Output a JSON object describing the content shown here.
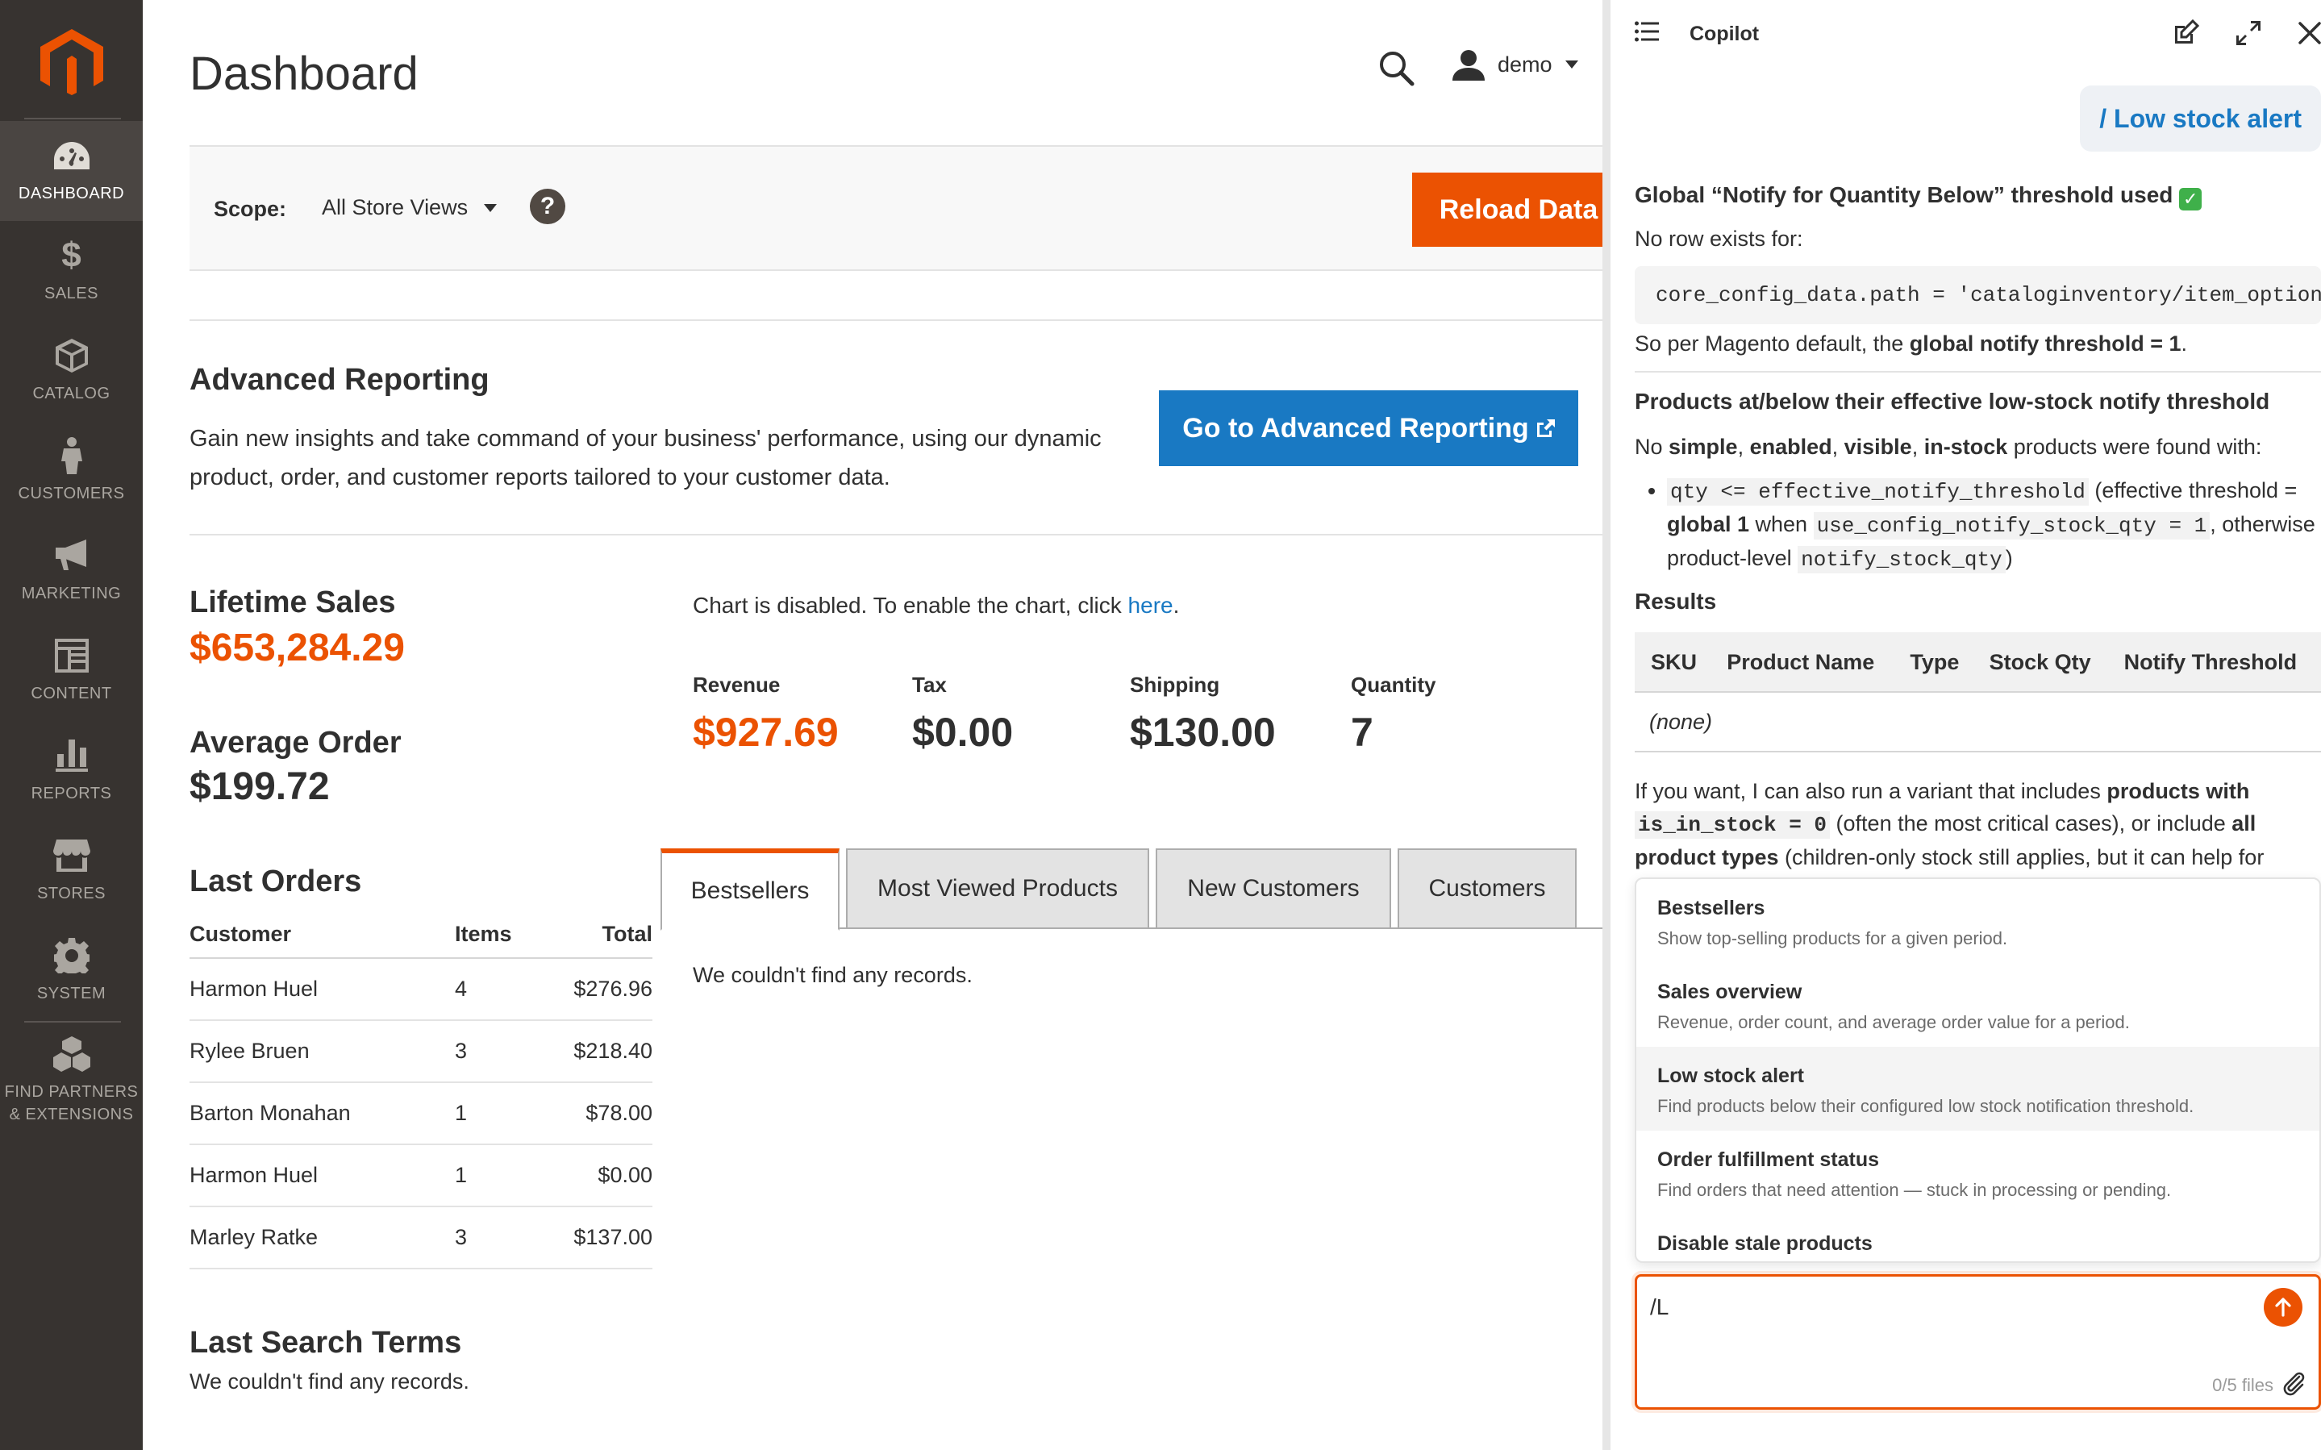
{
  "sidebar": {
    "items": [
      {
        "label": "DASHBOARD",
        "icon": "dashboard-icon",
        "active": true
      },
      {
        "label": "SALES",
        "icon": "dollar-icon"
      },
      {
        "label": "CATALOG",
        "icon": "box-icon"
      },
      {
        "label": "CUSTOMERS",
        "icon": "person-icon"
      },
      {
        "label": "MARKETING",
        "icon": "megaphone-icon"
      },
      {
        "label": "CONTENT",
        "icon": "layout-icon"
      },
      {
        "label": "REPORTS",
        "icon": "bar-chart-icon"
      },
      {
        "label": "STORES",
        "icon": "storefront-icon"
      },
      {
        "label": "SYSTEM",
        "icon": "gear-icon"
      },
      {
        "label_line1": "FIND PARTNERS",
        "label_line2": "& EXTENSIONS",
        "icon": "cubes-icon"
      }
    ],
    "sales_symbol": "$"
  },
  "header": {
    "title": "Dashboard",
    "user": "demo"
  },
  "scope": {
    "label": "Scope:",
    "value": "All Store Views",
    "help": "?",
    "reload_label": "Reload Data"
  },
  "advanced": {
    "title": "Advanced Reporting",
    "text": "Gain new insights and take command of your business' performance, using our dynamic product, order, and customer reports tailored to your customer data.",
    "button": "Go to Advanced Reporting"
  },
  "stats": {
    "lifetime_label": "Lifetime Sales",
    "lifetime_value": "$653,284.29",
    "average_label": "Average Order",
    "average_value": "$199.72"
  },
  "chart_note": {
    "text": "Chart is disabled. To enable the chart, click ",
    "link": "here",
    "tail": "."
  },
  "totals": [
    {
      "label": "Revenue",
      "value": "$927.69"
    },
    {
      "label": "Tax",
      "value": "$0.00"
    },
    {
      "label": "Shipping",
      "value": "$130.00"
    },
    {
      "label": "Quantity",
      "value": "7"
    }
  ],
  "last_orders": {
    "title": "Last Orders",
    "headers": [
      "Customer",
      "Items",
      "Total"
    ],
    "rows": [
      [
        "Harmon Huel",
        "4",
        "$276.96"
      ],
      [
        "Rylee Bruen",
        "3",
        "$218.40"
      ],
      [
        "Barton Monahan",
        "1",
        "$78.00"
      ],
      [
        "Harmon Huel",
        "1",
        "$0.00"
      ],
      [
        "Marley Ratke",
        "3",
        "$137.00"
      ]
    ]
  },
  "last_search": {
    "title": "Last Search Terms",
    "text": "We couldn't find any records."
  },
  "tabs": {
    "items": [
      "Bestsellers",
      "Most Viewed Products",
      "New Customers",
      "Customers"
    ],
    "active": 0,
    "content": "We couldn't find any records."
  },
  "copilot": {
    "title": "Copilot",
    "user_message": "/ Low stock alert",
    "h1": "Global “Notify for Quantity Below” threshold used",
    "no_row": "No row exists for:",
    "code": "core_config_data.path = 'cataloginventory/item_options/notify_stock_qty'",
    "per_default_prefix": "So per Magento default, the ",
    "per_default_bold": "global notify threshold = 1",
    "per_default_suffix": ".",
    "h2": "Products at/below their effective low-stock notify threshold",
    "p2_prefix": "No ",
    "p2_b1": "simple",
    "p2_s1": ", ",
    "p2_b2": "enabled",
    "p2_s2": ", ",
    "p2_b3": "visible",
    "p2_s3": ", ",
    "p2_b4": "in-stock",
    "p2_suffix": " products were found with:",
    "bullet_code1": "qty <= effective_notify_threshold",
    "bullet_t1": " (effective threshold = ",
    "bullet_b1": "global 1",
    "bullet_t2": " when ",
    "bullet_code2": "use_config_notify_stock_qty = 1",
    "bullet_t3": ", otherwise product-level ",
    "bullet_code3": "notify_stock_qty",
    "bullet_t4": ")",
    "results_label": "Results",
    "result_headers": [
      "SKU",
      "Product Name",
      "Type",
      "Stock Qty",
      "Notify Threshold"
    ],
    "result_empty": "(none)",
    "followup_t1": "If you want, I can also run a variant that includes ",
    "followup_b1": "products with",
    "followup_code": "is_in_stock = 0",
    "followup_t2": " (often the most critical cases), or include ",
    "followup_b2": "all product types",
    "followup_t3": " (children-only stock still applies, but it can help for",
    "suggestions": [
      {
        "title": "Bestsellers",
        "desc": "Show top-selling products for a given period."
      },
      {
        "title": "Sales overview",
        "desc": "Revenue, order count, and average order value for a period."
      },
      {
        "title": "Low stock alert",
        "desc": "Find products below their configured low stock notification threshold."
      },
      {
        "title": "Order fulfillment status",
        "desc": "Find orders that need attention — stuck in processing or pending."
      },
      {
        "title": "Disable stale products",
        "desc": ""
      }
    ],
    "input_value": "/L",
    "files_note": "0/5 files"
  },
  "colors": {
    "accent_orange": "#eb5202",
    "accent_blue": "#1979c3",
    "sidebar_bg": "#373330"
  }
}
